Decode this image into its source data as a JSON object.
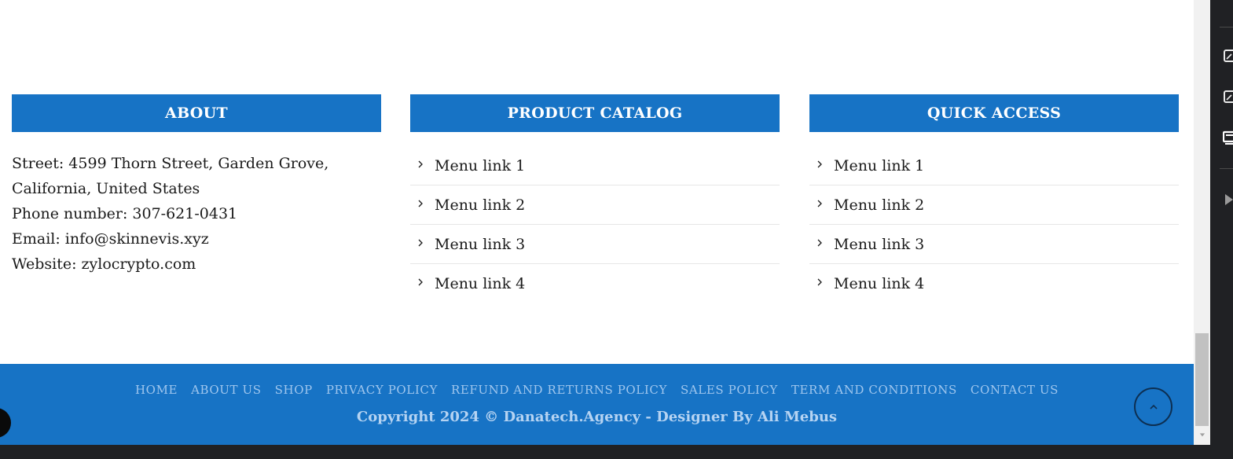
{
  "about": {
    "title": "ABOUT",
    "lines": [
      "Street: 4599 Thorn Street, Garden Grove,",
      "California, United States",
      "Phone number: 307-621-0431",
      "Email: info@skinnevis.xyz",
      "Website: zylocrypto.com"
    ]
  },
  "catalog": {
    "title": "PRODUCT CATALOG",
    "items": [
      "Menu link 1",
      "Menu link 2",
      "Menu link 3",
      "Menu link 4"
    ]
  },
  "quick": {
    "title": "QUICK ACCESS",
    "items": [
      "Menu link 1",
      "Menu link 2",
      "Menu link 3",
      "Menu link 4"
    ]
  },
  "footer": {
    "nav": [
      "HOME",
      "ABOUT US",
      "SHOP",
      "PRIVACY POLICY",
      "REFUND AND RETURNS POLICY",
      "SALES POLICY",
      "TERM AND CONDITIONS",
      "CONTACT US"
    ],
    "copyright": "Copyright 2024 © Danatech.Agency - Designer By Ali Mebus"
  },
  "icons": {
    "menu_chevron": "chevron-right-icon",
    "scroll_top": "chevron-up-icon"
  },
  "colors": {
    "brand_blue": "#1773c5",
    "footer_link": "#9fc6ee"
  }
}
